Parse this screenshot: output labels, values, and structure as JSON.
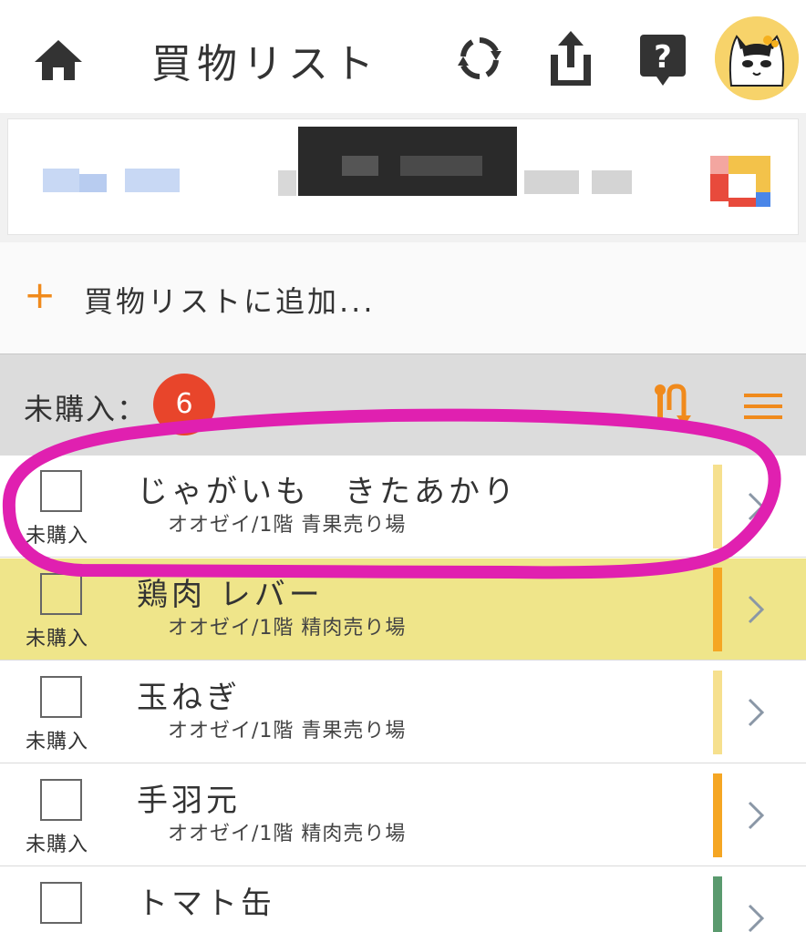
{
  "header": {
    "title": "買物リスト",
    "home_icon": "home-icon",
    "sync_icon": "sync-icon",
    "share_icon": "share-icon",
    "help_icon": "help-icon"
  },
  "add": {
    "plus": "+",
    "label": "買物リストに追加..."
  },
  "section": {
    "label": "未購入：",
    "count": "6"
  },
  "items": [
    {
      "name": "じゃがいも　きたあかり",
      "location": "オオゼイ/1階 青果売り場",
      "status": "未購入",
      "bar_color": "#f6e08e"
    },
    {
      "name": "鶏肉 レバー",
      "location": "オオゼイ/1階 精肉売り場",
      "status": "未購入",
      "bar_color": "#f5a623"
    },
    {
      "name": "玉ねぎ",
      "location": "オオゼイ/1階 青果売り場",
      "status": "未購入",
      "bar_color": "#f6e08e"
    },
    {
      "name": "手羽元",
      "location": "オオゼイ/1階 精肉売り場",
      "status": "未購入",
      "bar_color": "#f5a623"
    },
    {
      "name": "トマト缶",
      "location": "",
      "status": "",
      "bar_color": "#5a9a6e"
    }
  ],
  "colors": {
    "accent": "#f08a1c",
    "badge": "#e8452b",
    "annotation": "#e020b0"
  }
}
